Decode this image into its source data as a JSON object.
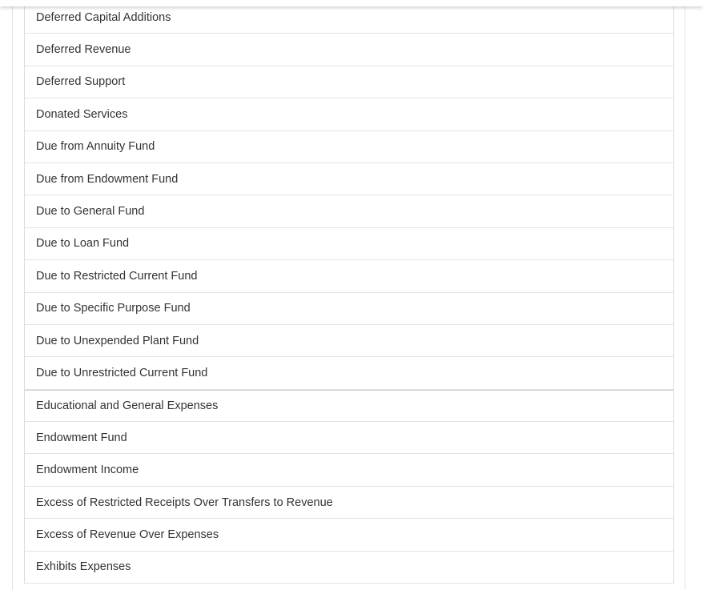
{
  "items": [
    "Deferred Capital Additions",
    "Deferred Revenue",
    "Deferred Support",
    "Donated Services",
    "Due from Annuity Fund",
    "Due from Endowment Fund",
    "Due to General Fund",
    "Due to Loan Fund",
    "Due to Restricted Current Fund",
    "Due to Specific Purpose Fund",
    "Due to Unexpended Plant Fund",
    "Due to Unrestricted Current Fund",
    "Educational and General Expenses",
    "Endowment Fund",
    "Endowment Income",
    "Excess of Restricted Receipts Over Transfers to Revenue",
    "Excess of Revenue Over Expenses",
    "Exhibits Expenses"
  ]
}
